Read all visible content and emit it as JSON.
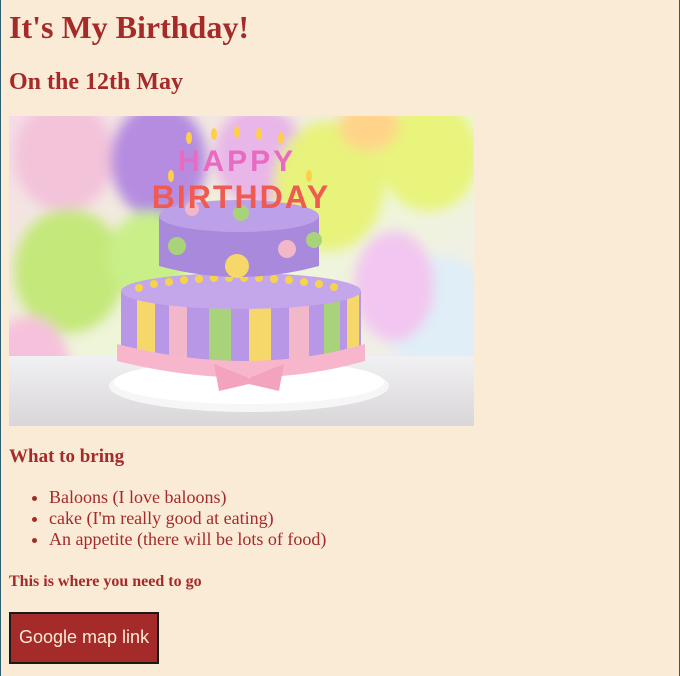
{
  "page": {
    "title": "It's My Birthday!",
    "date_heading": "On the 12th May",
    "image": {
      "alt": "Birthday cake",
      "candle_text_top": "HAPPY",
      "candle_text_bottom": "BIRTHDAY"
    },
    "bring_heading": "What to bring",
    "bring_items": [
      "Baloons (I love baloons)",
      "cake (I'm really good at eating)",
      "An appetite (there will be lots of food)"
    ],
    "where_heading": "This is where you need to go",
    "map_button": "Google map link"
  },
  "colors": {
    "background": "#faebd7",
    "text": "#a52a2a",
    "button_bg": "#a52a2a",
    "button_text": "#faebd7"
  }
}
